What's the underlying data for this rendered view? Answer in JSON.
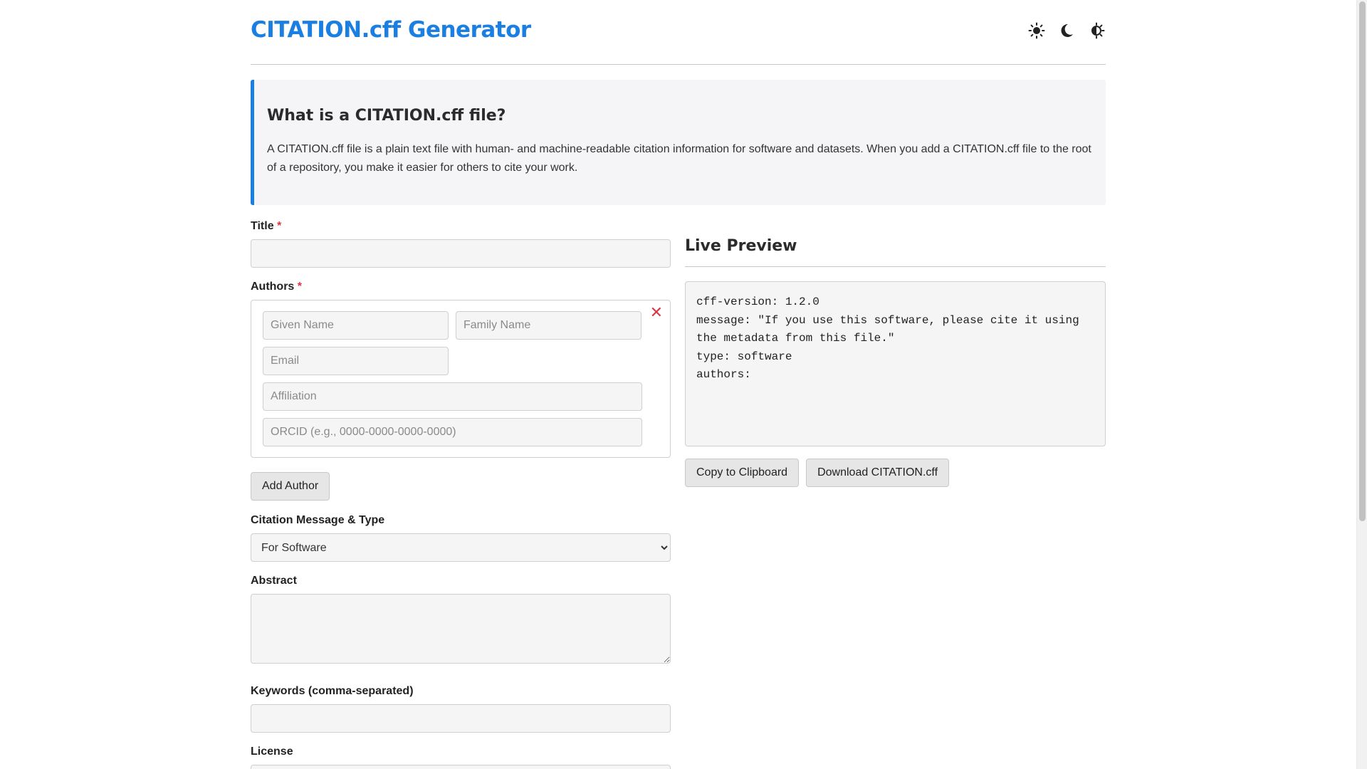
{
  "header": {
    "title": "CITATION.cff Generator",
    "theme_icons": [
      "sun-icon",
      "moon-icon",
      "auto-theme-icon"
    ]
  },
  "intro": {
    "heading": "What is a CITATION.cff file?",
    "body": "A CITATION.cff file is a plain text file with human- and machine-readable citation information for software and datasets. When you add a CITATION.cff file to the root of a repository, you make it easier for others to cite your work."
  },
  "form": {
    "title_label": "Title",
    "title_value": "",
    "authors_label": "Authors",
    "required_marker": "*",
    "author": {
      "given_name_placeholder": "Given Name",
      "family_name_placeholder": "Family Name",
      "email_placeholder": "Email",
      "affiliation_placeholder": "Affiliation",
      "orcid_placeholder": "ORCID (e.g., 0000-0000-0000-0000)",
      "remove_symbol": "✕"
    },
    "add_author_label": "Add Author",
    "message_type_label": "Citation Message & Type",
    "message_type_selected": "For Software",
    "abstract_label": "Abstract",
    "keywords_label": "Keywords (comma-separated)",
    "license_label": "License"
  },
  "preview": {
    "title": "Live Preview",
    "content": "cff-version: 1.2.0\nmessage: \"If you use this software, please cite it using\nthe metadata from this file.\"\ntype: software\nauthors:",
    "copy_label": "Copy to Clipboard",
    "download_label": "Download CITATION.cff"
  },
  "colors": {
    "accent": "#1a7fe0",
    "required": "#dc3545",
    "panel_bg": "#f5f5f7"
  }
}
